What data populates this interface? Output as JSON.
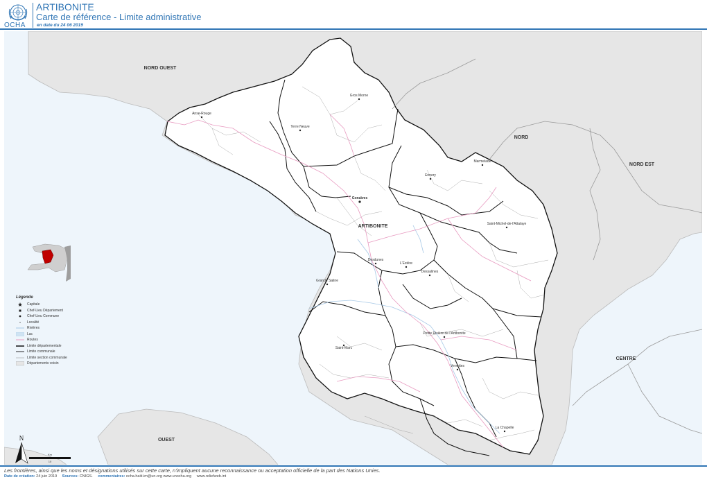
{
  "header": {
    "org": "OCHA",
    "title": "ARTIBONITE",
    "subtitle": "Carte de référence - Limite administrative",
    "date_line": "en date du 24 06 2019"
  },
  "colors": {
    "accent": "#2f75b5",
    "sea": "#eef5fb",
    "land_neighbour": "#e6e6e6",
    "land_artibonite": "#ffffff",
    "road": "#e89ac0",
    "river": "#a6c8e6"
  },
  "map": {
    "regions": {
      "nord_ouest": "NORD OUEST",
      "nord": "NORD",
      "nord_est": "NORD EST",
      "artibonite": "ARTIBONITE",
      "centre": "CENTRE",
      "ouest": "OUEST"
    },
    "places": {
      "anse_rouge": "Anse-Rouge",
      "terre_neuve": "Terre Neuve",
      "gros_morne": "Gros Morne",
      "marmelade": "Marmelade",
      "ennery": "Ennery",
      "gonaives": "Gonaïves",
      "st_michel": "Saint-Michel-de-l'Attalaye",
      "desdunes": "Desdunes",
      "grande_saline": "Grande Saline",
      "dessalines": "Dessalines",
      "petite_riviere": "Petite Rivière de l'Artibonite",
      "saint_marc": "Saint-Marc",
      "verrettes": "Verrettes",
      "la_chapelle": "La Chapelle",
      "estere": "L'Estère"
    }
  },
  "legend": {
    "title": "Légende",
    "items": [
      {
        "label": "Capitale"
      },
      {
        "label": "Chef-Lieu Département"
      },
      {
        "label": "Chef-Lieu Commune"
      },
      {
        "label": "Localité"
      },
      {
        "label": "Rivières"
      },
      {
        "label": "Lac"
      },
      {
        "label": "Routes"
      },
      {
        "label": "Limite départementale"
      },
      {
        "label": "Limite communale"
      },
      {
        "label": "Limite section communale"
      },
      {
        "label": "Départements voisin"
      }
    ]
  },
  "north_arrow": {
    "label": "N"
  },
  "scale_bar": {
    "unit": "Km",
    "value": "10"
  },
  "footer": {
    "disclaimer": "Les frontières, ainsi que les noms et désignations utilisés sur cette carte, n'impliquent aucune reconnaissance ou acceptation officielle de la part des Nations Unies.",
    "creation_label": "Date de création:",
    "creation_value": "24 juin 2019",
    "sources_label": "Sources:",
    "sources_value": "CNIGS.",
    "comments_label": "commentaires:",
    "comments_value": "ocha.haiti.im@un.org www.unocha.org",
    "reliefweb": "www.reliefweb.int"
  }
}
